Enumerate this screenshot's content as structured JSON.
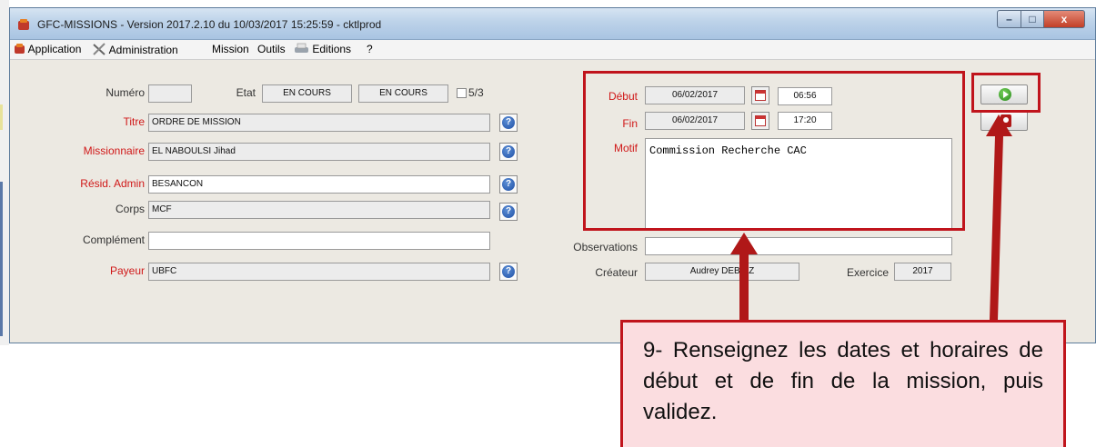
{
  "window": {
    "title": "GFC-MISSIONS - Version 2017.2.10 du 10/03/2017 15:25:59 - cktlprod",
    "controls": {
      "minimize": "–",
      "maximize": "□",
      "close": "x"
    }
  },
  "menu": {
    "items": [
      {
        "label": "Application",
        "icon": "app-icon"
      },
      {
        "label": "Administration",
        "icon": "tools-icon"
      },
      {
        "label": "Mission"
      },
      {
        "label": "Outils"
      },
      {
        "label": "Editions",
        "icon": "printer-icon"
      },
      {
        "label": "?"
      }
    ]
  },
  "form": {
    "numero": {
      "label": "Numéro",
      "value": ""
    },
    "etat": {
      "label": "Etat",
      "value1": "EN COURS",
      "value2": "EN COURS",
      "checkbox_label": "5/3",
      "checked": false
    },
    "titre": {
      "label": "Titre",
      "value": "ORDRE DE MISSION"
    },
    "missionnaire": {
      "label": "Missionnaire",
      "value": "EL NABOULSI Jihad"
    },
    "resid_admin": {
      "label": "Résid. Admin",
      "value": "BESANCON"
    },
    "corps": {
      "label": "Corps",
      "value": "MCF"
    },
    "complement": {
      "label": "Complément",
      "value": ""
    },
    "payeur": {
      "label": "Payeur",
      "value": "UBFC"
    },
    "help_glyph": "?"
  },
  "dates": {
    "debut": {
      "label": "Début",
      "date": "06/02/2017",
      "time": "06:56"
    },
    "fin": {
      "label": "Fin",
      "date": "06/02/2017",
      "time": "17:20"
    },
    "motif": {
      "label": "Motif",
      "value": "Commission Recherche CAC"
    },
    "observations": {
      "label": "Observations",
      "value": ""
    },
    "createur": {
      "label": "Créateur",
      "value": "Audrey DEBIEZ"
    },
    "exercice": {
      "label": "Exercice",
      "value": "2017"
    }
  },
  "callout": {
    "text": "9- Renseignez les dates et horaires de début et de fin de la mission, puis validez."
  },
  "colors": {
    "highlight": "#c0141c",
    "callout_bg": "#fbdde0",
    "required_label": "#d01818",
    "validate_icon": "#2a8a1e",
    "cancel_icon": "#b01818"
  }
}
